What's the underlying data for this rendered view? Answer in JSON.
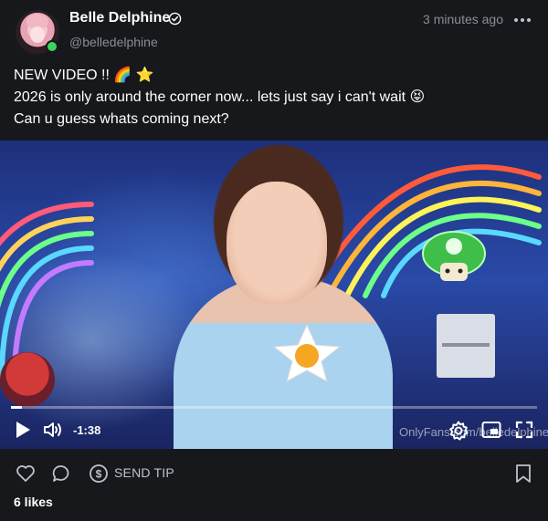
{
  "post": {
    "author_name": "Belle Delphine",
    "handle": "@belledelphine",
    "timestamp": "3 minutes ago",
    "lines": [
      "NEW VIDEO !! 🌈 ⭐",
      "2026 is only around the corner now... lets just say i can't wait 😝",
      "Can u guess whats coming next?"
    ],
    "video": {
      "time_remaining": "-1:38",
      "progress": 0.02,
      "watermark": "OnlyFans.com/belledelphine"
    },
    "actions": {
      "send_tip_label": "SEND TIP"
    },
    "likes": "6 likes"
  },
  "colors": {
    "background": "#16181c",
    "secondary_text": "#8a8d91",
    "online": "#3ed35b"
  },
  "icons": [
    "verified-icon",
    "more-icon",
    "play-icon",
    "volume-icon",
    "settings-icon",
    "pip-icon",
    "fullscreen-icon",
    "heart-icon",
    "comment-icon",
    "dollar-icon",
    "bookmark-icon"
  ]
}
